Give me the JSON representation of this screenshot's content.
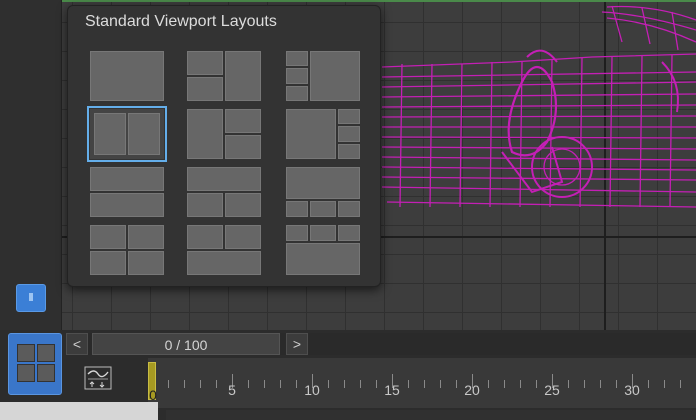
{
  "flyout": {
    "title": "Standard Viewport Layouts",
    "selected_option": "layout-2-vertical"
  },
  "time_slider": {
    "prev_label": "<",
    "next_label": ">",
    "frame_readout": "0 / 100"
  },
  "timeline": {
    "current_frame": "0",
    "tick_labels": [
      "5",
      "10",
      "15",
      "20",
      "25",
      "30"
    ]
  },
  "colors": {
    "wireframe": "#c41fb5",
    "selection_outline": "#64aeea",
    "active_button": "#3a76c9",
    "time_cursor": "#a69a22"
  },
  "icons": {
    "layout_toggle": "viewport-layout-icon",
    "curve_editor": "curve-editor-icon"
  }
}
